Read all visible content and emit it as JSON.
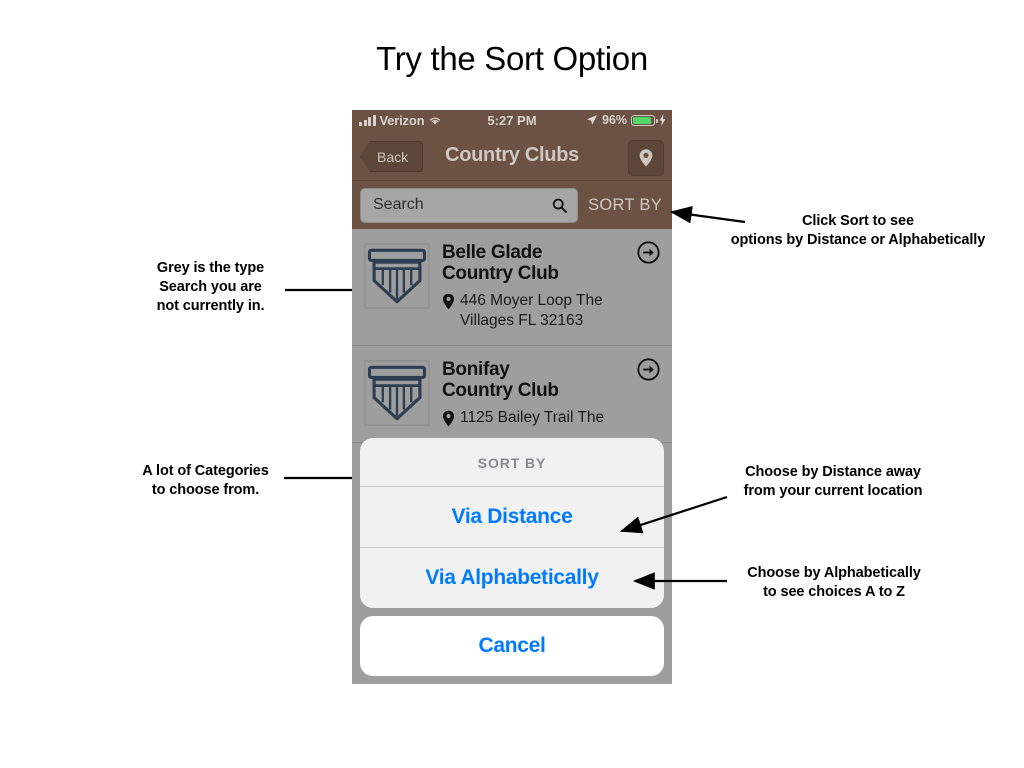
{
  "page": {
    "title": "Try the Sort Option"
  },
  "phone": {
    "statusbar": {
      "carrier": "Verizon",
      "signal_icon": "signal-bars-icon",
      "wifi_icon": "wifi-icon",
      "time": "5:27 PM",
      "location_icon": "location-arrow-icon",
      "battery_percent": "96%",
      "battery_icon": "battery-icon",
      "charging_icon": "lightning-bolt-icon"
    },
    "navbar": {
      "back_label": "Back",
      "title": "Country Clubs",
      "map_button_icon": "map-pin-icon"
    },
    "searchbar": {
      "placeholder": "Search",
      "value": "",
      "search_icon": "search-icon",
      "sort_by_label": "SORT BY"
    },
    "list": {
      "rows": [
        {
          "icon": "country-club-crest-icon",
          "name": "Belle Glade\nCountry Club",
          "name_line1": "Belle Glade",
          "name_line2": "Country Club",
          "address_line1": "446 Moyer Loop The",
          "address_line2": "Villages FL 32163",
          "pin_icon": "map-pin-icon",
          "arrow_icon": "circle-arrow-right-icon"
        },
        {
          "icon": "country-club-crest-icon",
          "name_line1": "Bonifay",
          "name_line2": "Country Club",
          "address_line1": "1125 Bailey Trail The",
          "address_line2": "",
          "pin_icon": "map-pin-icon",
          "arrow_icon": "circle-arrow-right-icon"
        }
      ]
    },
    "action_sheet": {
      "title": "SORT BY",
      "options": [
        {
          "label": "Via Distance"
        },
        {
          "label": "Via Alphabetically"
        }
      ],
      "cancel_label": "Cancel"
    }
  },
  "annotations": [
    {
      "id": "anno-search-grey",
      "line1": "Grey is the type",
      "line2": "Search you are",
      "line3": "not currently in."
    },
    {
      "id": "anno-categories",
      "line1": "A lot of Categories",
      "line2": "to choose from."
    },
    {
      "id": "anno-click-sort",
      "line1": "Click Sort to see",
      "line2": "options by Distance or Alphabetically"
    },
    {
      "id": "anno-via-distance",
      "line1": "Choose by Distance away",
      "line2": "from your current location"
    },
    {
      "id": "anno-via-alpha",
      "line1": "Choose by Alphabetically",
      "line2": "to see choices A to Z"
    }
  ],
  "colors": {
    "nav_brown": "#6b5243",
    "screen_grey": "#9e9e9e",
    "ios_blue": "#007aff",
    "crest_navy": "#2e3e52",
    "battery_green": "#53d769"
  }
}
